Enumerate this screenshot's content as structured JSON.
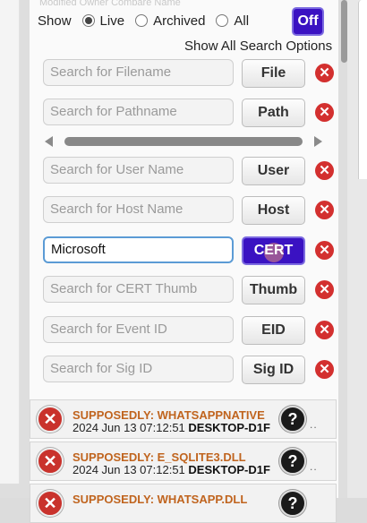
{
  "header": {
    "top_fade_text": "Modified   Owner   Compare   Name"
  },
  "filter": {
    "show_label": "Show",
    "options": [
      {
        "label": "Live",
        "selected": true
      },
      {
        "label": "Archived",
        "selected": false
      },
      {
        "label": "All",
        "selected": false
      }
    ],
    "toggle_label": "Off",
    "show_all_options_label": "Show All Search Options"
  },
  "search_rows": [
    {
      "placeholder": "Search for Filename",
      "value": "",
      "button": "File"
    },
    {
      "placeholder": "Search for Pathname",
      "value": "",
      "button": "Path"
    },
    {
      "placeholder": "Search for User Name",
      "value": "",
      "button": "User"
    },
    {
      "placeholder": "Search for Host Name",
      "value": "",
      "button": "Host"
    },
    {
      "placeholder": "",
      "value": "Microsoft",
      "button": "CERT"
    },
    {
      "placeholder": "Search for CERT Thumb",
      "value": "",
      "button": "Thumb"
    },
    {
      "placeholder": "Search for Event ID",
      "value": "",
      "button": "EID"
    },
    {
      "placeholder": "Search for Sig ID",
      "value": "",
      "button": "Sig ID"
    }
  ],
  "icons": {
    "clear": "close-circle-icon",
    "help": "question-circle-icon"
  },
  "results": [
    {
      "name": "SUPPOSEDLY: WHATSAPPNATIVE",
      "timestamp": "2024 Jun 13 07:12:51",
      "host": "DESKTOP-D1F",
      "more": ".."
    },
    {
      "name": "SUPPOSEDLY: E_SQLITE3.DLL",
      "timestamp": "2024 Jun 13 07:12:51",
      "host": "DESKTOP-D1F",
      "more": ".."
    },
    {
      "name": "SUPPOSEDLY: WHATSAPP.DLL",
      "timestamp": "",
      "host": "",
      "more": ""
    }
  ],
  "colors": {
    "accent": "#3a12c2",
    "danger": "#d3302f",
    "result_name": "#c0641e"
  }
}
